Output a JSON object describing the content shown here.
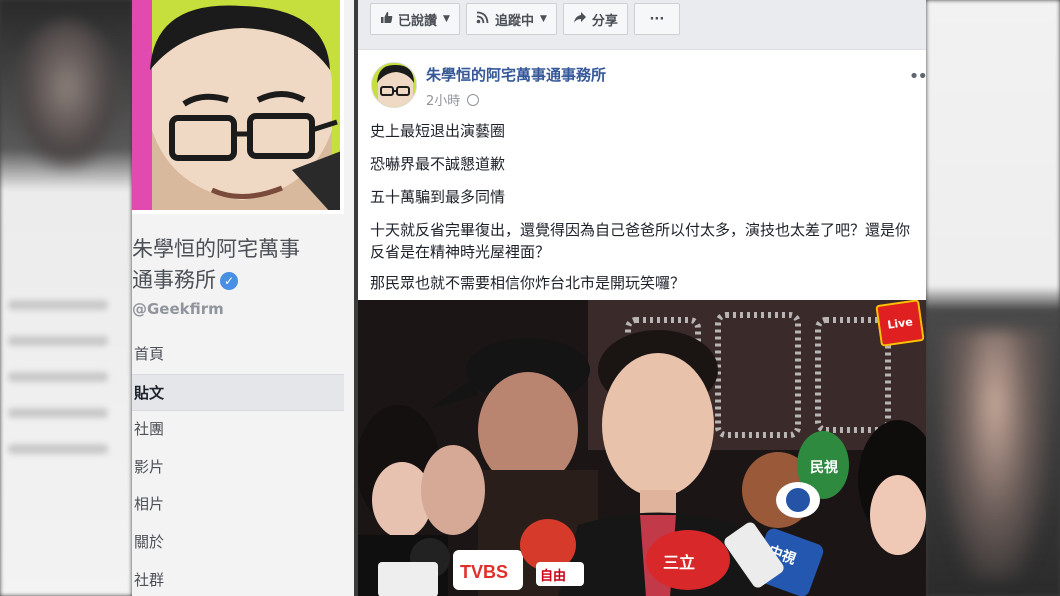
{
  "page": {
    "name": "朱學恒的阿宅萬事通事務所",
    "name_line1": "朱學恒的阿宅萬事",
    "name_line2": "通事務所",
    "handle": "@Geekfirm",
    "verified_icon": "✓"
  },
  "sidebar": {
    "items": [
      {
        "label": "首頁",
        "active": false
      },
      {
        "label": "貼文",
        "active": true
      },
      {
        "label": "社團",
        "active": false
      },
      {
        "label": "影片",
        "active": false
      },
      {
        "label": "相片",
        "active": false
      },
      {
        "label": "關於",
        "active": false
      },
      {
        "label": "社群",
        "active": false
      }
    ]
  },
  "action_bar": {
    "liked_label": "已說讚",
    "liked_icon": "thumbs-up-icon",
    "following_label": "追蹤中",
    "following_icon": "rss-icon",
    "share_label": "分享",
    "share_icon": "share-arrow-icon",
    "more_label": "···"
  },
  "post": {
    "author": "朱學恒的阿宅萬事通事務所",
    "time": "2小時",
    "privacy_icon": "globe-icon",
    "more_label": "••",
    "lines": [
      "史上最短退出演藝圈",
      "恐嚇界最不誠懇道歉",
      "五十萬騙到最多同情",
      "十天就反省完畢復出，還覺得因為自己爸爸所以付太多，演技也太差了吧？還是你反省是在精神時光屋裡面？",
      "那民眾也就不需要相信你炸台北市是開玩笑囉？"
    ],
    "photo": {
      "badge": "Live",
      "mic_labels": [
        "TVBS",
        "中視",
        "自由",
        "三立"
      ]
    }
  },
  "colors": {
    "link": "#365899",
    "profile_bg": "#c7df3c",
    "verified": "#4a90e2"
  }
}
